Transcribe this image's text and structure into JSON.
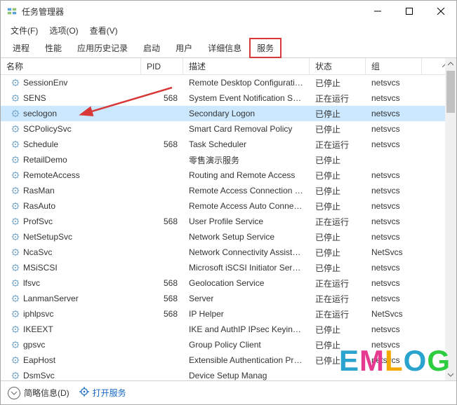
{
  "window": {
    "title": "任务管理器"
  },
  "menubar": {
    "items": [
      "文件(F)",
      "选项(O)",
      "查看(V)"
    ]
  },
  "tabs": {
    "items": [
      "进程",
      "性能",
      "应用历史记录",
      "启动",
      "用户",
      "详细信息",
      "服务"
    ],
    "activeIndex": 6
  },
  "columns": {
    "name": "名称",
    "pid": "PID",
    "desc": "描述",
    "status": "状态",
    "group": "组"
  },
  "sort": {
    "column": "name",
    "direction": "asc"
  },
  "selectedRowIndex": 2,
  "rows": [
    {
      "name": "SessionEnv",
      "pid": "",
      "desc": "Remote Desktop Configuration",
      "status": "已停止",
      "group": "netsvcs"
    },
    {
      "name": "SENS",
      "pid": "568",
      "desc": "System Event Notification Servi...",
      "status": "正在运行",
      "group": "netsvcs"
    },
    {
      "name": "seclogon",
      "pid": "",
      "desc": "Secondary Logon",
      "status": "已停止",
      "group": "netsvcs"
    },
    {
      "name": "SCPolicySvc",
      "pid": "",
      "desc": "Smart Card Removal Policy",
      "status": "已停止",
      "group": "netsvcs"
    },
    {
      "name": "Schedule",
      "pid": "568",
      "desc": "Task Scheduler",
      "status": "正在运行",
      "group": "netsvcs"
    },
    {
      "name": "RetailDemo",
      "pid": "",
      "desc": "零售演示服务",
      "status": "已停止",
      "group": ""
    },
    {
      "name": "RemoteAccess",
      "pid": "",
      "desc": "Routing and Remote Access",
      "status": "已停止",
      "group": "netsvcs"
    },
    {
      "name": "RasMan",
      "pid": "",
      "desc": "Remote Access Connection Ma...",
      "status": "已停止",
      "group": "netsvcs"
    },
    {
      "name": "RasAuto",
      "pid": "",
      "desc": "Remote Access Auto Connectio...",
      "status": "已停止",
      "group": "netsvcs"
    },
    {
      "name": "ProfSvc",
      "pid": "568",
      "desc": "User Profile Service",
      "status": "正在运行",
      "group": "netsvcs"
    },
    {
      "name": "NetSetupSvc",
      "pid": "",
      "desc": "Network Setup Service",
      "status": "已停止",
      "group": "netsvcs"
    },
    {
      "name": "NcaSvc",
      "pid": "",
      "desc": "Network Connectivity Assistant",
      "status": "已停止",
      "group": "NetSvcs"
    },
    {
      "name": "MSiSCSI",
      "pid": "",
      "desc": "Microsoft iSCSI Initiator Service",
      "status": "已停止",
      "group": "netsvcs"
    },
    {
      "name": "lfsvc",
      "pid": "568",
      "desc": "Geolocation Service",
      "status": "正在运行",
      "group": "netsvcs"
    },
    {
      "name": "LanmanServer",
      "pid": "568",
      "desc": "Server",
      "status": "正在运行",
      "group": "netsvcs"
    },
    {
      "name": "iphlpsvc",
      "pid": "568",
      "desc": "IP Helper",
      "status": "正在运行",
      "group": "NetSvcs"
    },
    {
      "name": "IKEEXT",
      "pid": "",
      "desc": "IKE and AuthIP IPsec Keying M...",
      "status": "已停止",
      "group": "netsvcs"
    },
    {
      "name": "gpsvc",
      "pid": "",
      "desc": "Group Policy Client",
      "status": "已停止",
      "group": "netsvcs"
    },
    {
      "name": "EapHost",
      "pid": "",
      "desc": "Extensible Authentication Proto...",
      "status": "已停止",
      "group": "netsvcs"
    },
    {
      "name": "DsmSvc",
      "pid": "",
      "desc": "Device Setup Manag",
      "status": "",
      "group": ""
    }
  ],
  "statusbar": {
    "brief": "简略信息(D)",
    "open_services": "打开服务"
  },
  "watermark": "EMLOG"
}
